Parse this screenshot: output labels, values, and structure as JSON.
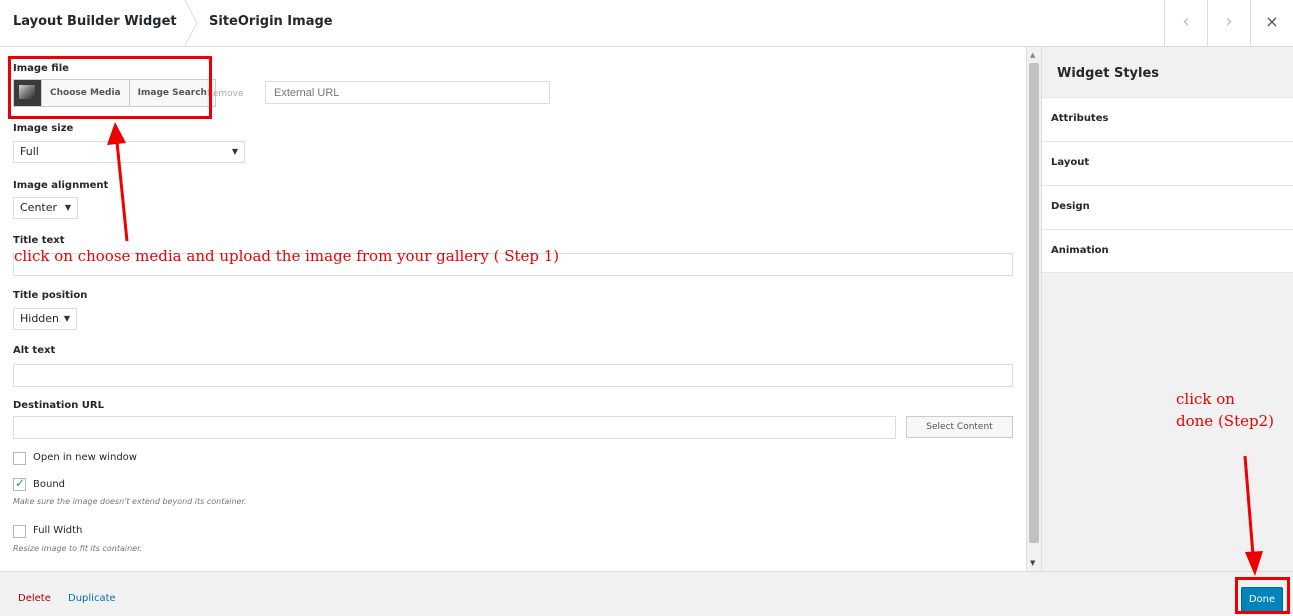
{
  "header": {
    "breadcrumb_1": "Layout Builder Widget",
    "breadcrumb_2": "SiteOrigin Image",
    "prev_icon": "‹",
    "next_icon": "›",
    "close_icon": "×"
  },
  "form": {
    "image_file": {
      "label": "Image file",
      "choose_media": "Choose Media",
      "image_search": "Image Search",
      "remove": "Remove",
      "external_url_placeholder": "External URL"
    },
    "image_size": {
      "label": "Image size",
      "value": "Full"
    },
    "image_alignment": {
      "label": "Image alignment",
      "value": "Center"
    },
    "title_text": {
      "label": "Title text",
      "value": ""
    },
    "title_position": {
      "label": "Title position",
      "value": "Hidden"
    },
    "alt_text": {
      "label": "Alt text",
      "value": ""
    },
    "destination_url": {
      "label": "Destination URL",
      "value": "",
      "select_content": "Select Content"
    },
    "open_new_window": {
      "label": "Open in new window",
      "checked": false
    },
    "bound": {
      "label": "Bound",
      "checked": true,
      "description": "Make sure the image doesn't extend beyond its container."
    },
    "full_width": {
      "label": "Full Width",
      "checked": false,
      "description": "Resize image to fit its container."
    }
  },
  "sidebar": {
    "title": "Widget Styles",
    "sections": [
      "Attributes",
      "Layout",
      "Design",
      "Animation"
    ]
  },
  "footer": {
    "delete": "Delete",
    "duplicate": "Duplicate",
    "done": "Done"
  },
  "annotations": {
    "step1": "click on choose media and upload the image from your gallery ( Step 1)",
    "step2_line1": "click on",
    "step2_line2": "done (Step2)"
  },
  "colors": {
    "annotation": "#e00000",
    "primary_button": "#0085ba",
    "delete_link": "#aa0000",
    "link": "#0073aa"
  }
}
